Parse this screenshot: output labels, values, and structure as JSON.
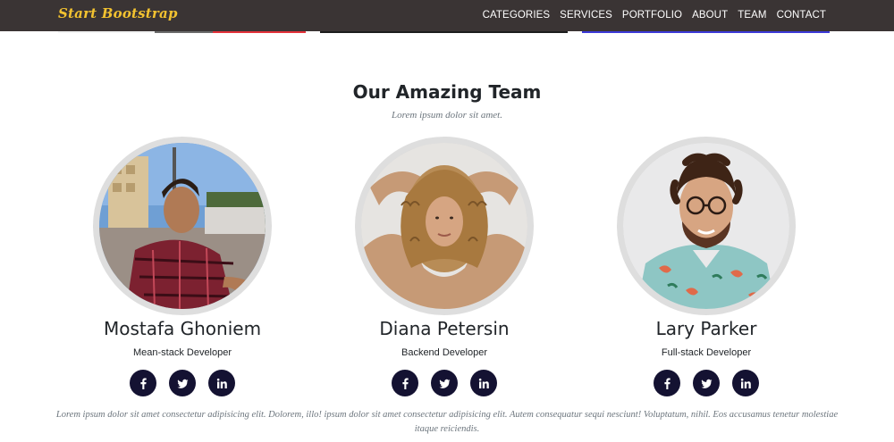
{
  "navbar": {
    "brand": "Start Bootstrap",
    "links": [
      "CATEGORIES",
      "SERVICES",
      "PORTFOLIO",
      "ABOUT",
      "TEAM",
      "CONTACT"
    ]
  },
  "team_section": {
    "title": "Our Amazing Team",
    "subtitle": "Lorem ipsum dolor sit amet.",
    "members": [
      {
        "name": "Mostafa Ghoniem",
        "role": "Mean-stack Developer",
        "socials": [
          "facebook-icon",
          "twitter-icon",
          "linkedin-icon"
        ]
      },
      {
        "name": "Diana Petersin",
        "role": "Backend Developer",
        "socials": [
          "facebook-icon",
          "twitter-icon",
          "linkedin-icon"
        ]
      },
      {
        "name": "Lary Parker",
        "role": "Full-stack Developer",
        "socials": [
          "facebook-icon",
          "twitter-icon",
          "linkedin-icon"
        ]
      }
    ],
    "footer": "Lorem ipsum dolor sit amet consectetur adipisicing elit. Dolorem, illo! ipsum dolor sit amet consectetur adipisicing elit. Autem consequatur sequi nesciunt! Voluptatum, nihil. Eos accusamus tenetur molestiae itaque reiciendis."
  },
  "colors": {
    "navbar_bg": "#3a3434",
    "brand": "#f2c230",
    "social_bg": "#141232",
    "avatar_ring": "#dedede"
  }
}
